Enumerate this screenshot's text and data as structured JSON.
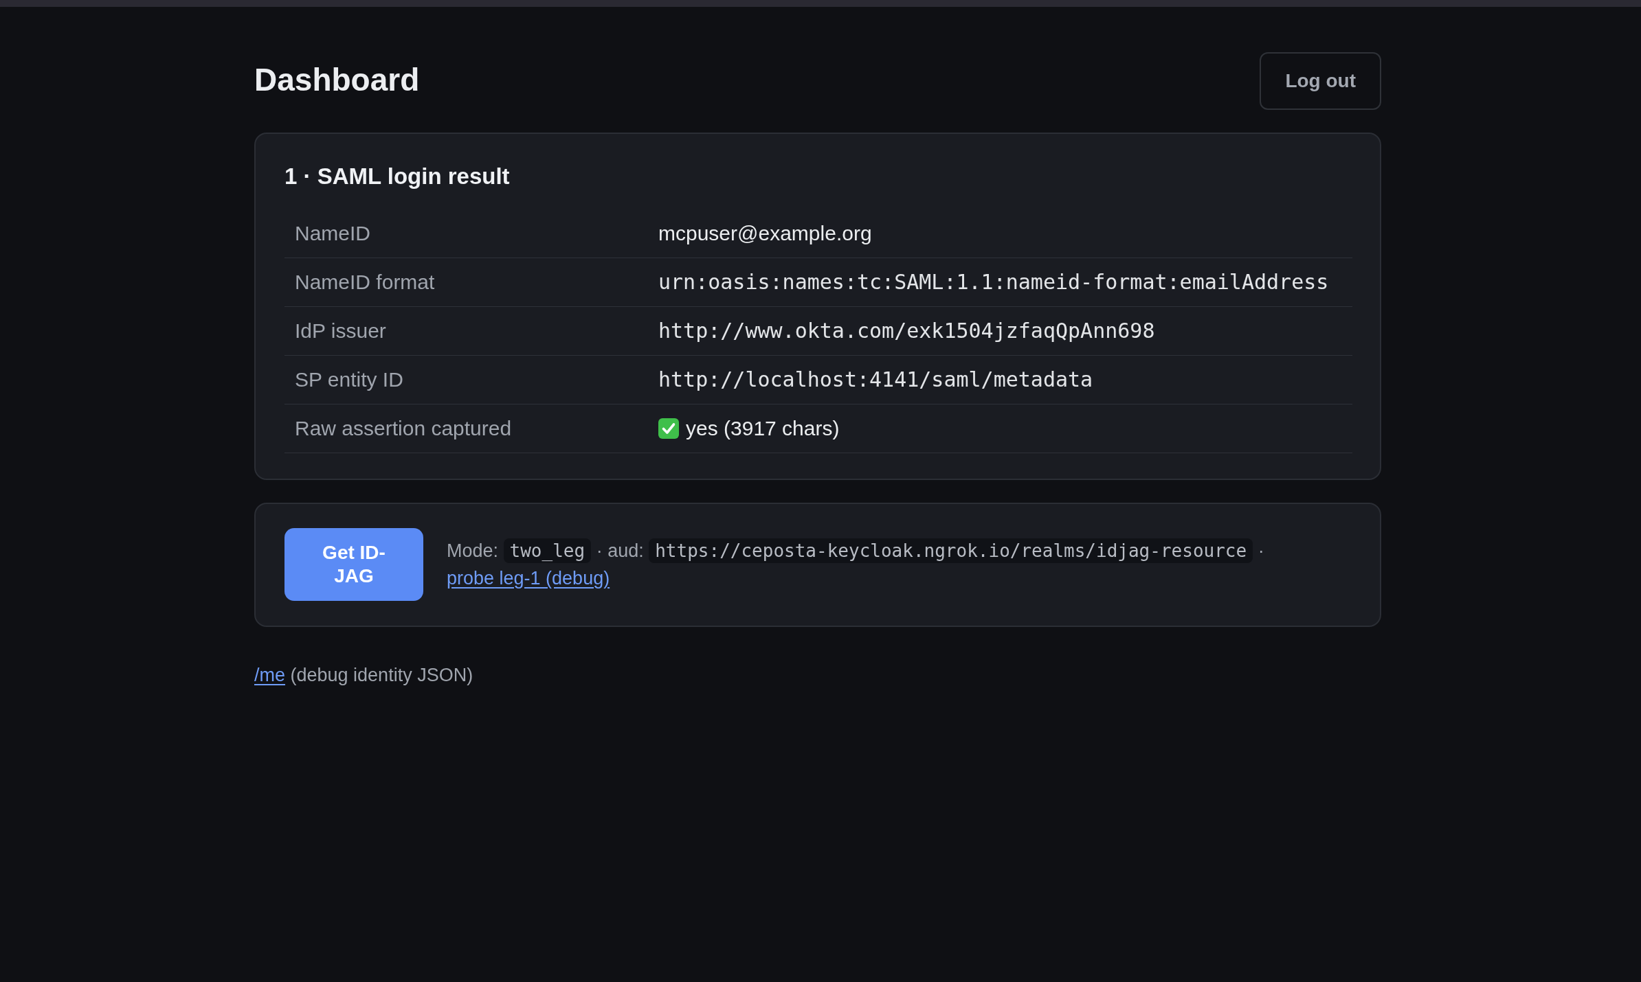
{
  "header": {
    "title": "Dashboard",
    "logout_button": "Log out"
  },
  "saml_card": {
    "title": "1 · SAML login result",
    "rows": [
      {
        "label": "NameID",
        "value": "mcpuser@example.org",
        "kind": "text"
      },
      {
        "label": "NameID format",
        "value": "urn:oasis:names:tc:SAML:1.1:nameid-format:emailAddress",
        "kind": "code"
      },
      {
        "label": "IdP issuer",
        "value": "http://www.okta.com/exk1504jzfaqQpAnn698",
        "kind": "code"
      },
      {
        "label": "SP entity ID",
        "value": "http://localhost:4141/saml/metadata",
        "kind": "code"
      },
      {
        "label": "Raw assertion captured",
        "value": "yes (3917 chars)",
        "kind": "check"
      }
    ]
  },
  "action_card": {
    "button": "Get ID-JAG",
    "details": [
      {
        "kind": "label",
        "text": "Mode:"
      },
      {
        "kind": "code",
        "text": "two_leg"
      },
      {
        "kind": "label",
        "text": "· aud:"
      },
      {
        "kind": "code",
        "text": "https://ceposta-keycloak.ngrok.io/realms/idjag-resource"
      },
      {
        "kind": "label",
        "text": "·"
      },
      {
        "kind": "link",
        "text": "probe leg-1 (debug)"
      }
    ]
  },
  "footer": {
    "link": "/me",
    "text": "(debug identity JSON)"
  }
}
